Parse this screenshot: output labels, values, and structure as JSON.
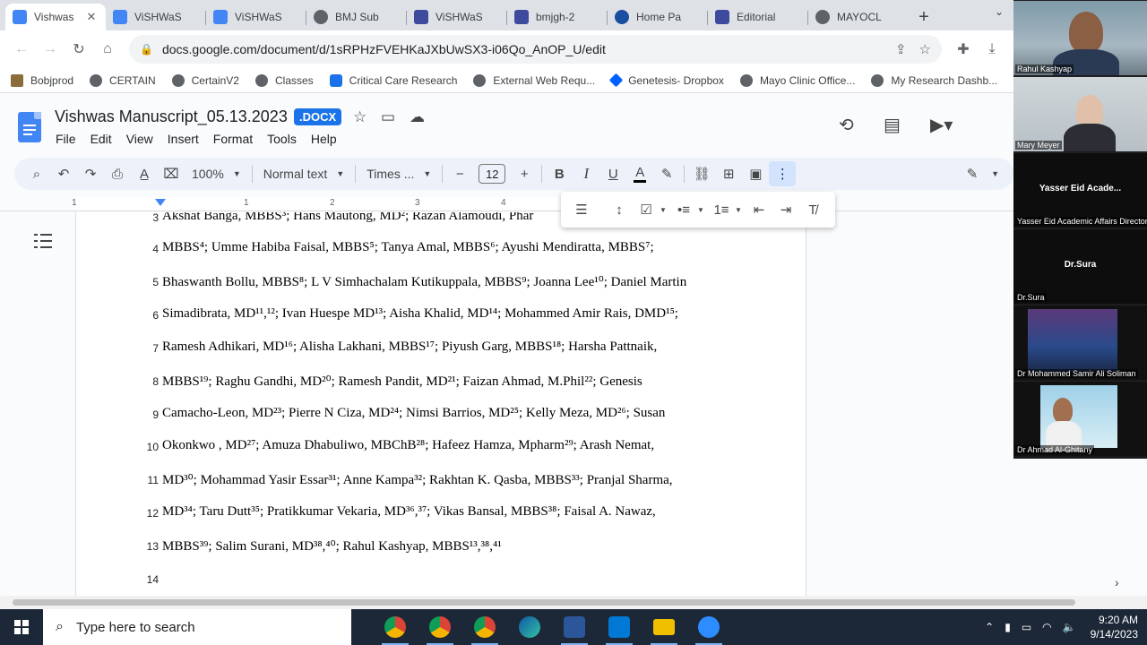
{
  "tabs": [
    {
      "title": "Vishwas",
      "favicon": "docs",
      "active": true
    },
    {
      "title": "ViSHWaS",
      "favicon": "docs"
    },
    {
      "title": "ViSHWaS",
      "favicon": "docs"
    },
    {
      "title": "BMJ Sub",
      "favicon": "globe"
    },
    {
      "title": "ViSHWaS",
      "favicon": "d-logo"
    },
    {
      "title": "bmjgh-2",
      "favicon": "d-logo"
    },
    {
      "title": "Home Pa",
      "favicon": "home"
    },
    {
      "title": "Editorial",
      "favicon": "d-logo"
    },
    {
      "title": "MAYOCL",
      "favicon": "globe"
    }
  ],
  "address": {
    "url": "docs.google.com/document/d/1sRPHzFVEHKaJXbUwSX3-i06Qo_AnOP_U/edit"
  },
  "bookmarks": [
    "Bobjprod",
    "CERTAIN",
    "CertainV2",
    "Classes",
    "Critical Care Research",
    "External Web Requ...",
    "Genetesis- Dropbox",
    "Mayo Clinic Office...",
    "My Research Dashb..."
  ],
  "doc": {
    "title": "Vishwas Manuscript_05.13.2023",
    "badge": ".DOCX",
    "menu": [
      "File",
      "Edit",
      "View",
      "Insert",
      "Format",
      "Tools",
      "Help"
    ]
  },
  "toolbar": {
    "zoom": "100%",
    "style": "Normal text",
    "font": "Times ...",
    "font_size": "12"
  },
  "ruler": [
    "1",
    "1",
    "2",
    "3",
    "4"
  ],
  "lines": [
    {
      "n": "3",
      "text": "Akshat Banga, MBBS³; Hans Mautong, MD²; Razan Alamoudi, Phar"
    },
    {
      "n": "4",
      "text": "MBBS⁴; Umme Habiba Faisal, MBBS⁵; Tanya Amal, MBBS⁶; Ayushi Mendiratta, MBBS⁷;"
    },
    {
      "n": "5",
      "text": "Bhaswanth Bollu, MBBS⁸; L V Simhachalam Kutikuppala, MBBS⁹; Joanna Lee¹⁰; Daniel Martin"
    },
    {
      "n": "6",
      "text": "Simadibrata, MD¹¹,¹²; Ivan Huespe MD¹³; Aisha Khalid, MD¹⁴; Mohammed Amir Rais, DMD¹⁵;"
    },
    {
      "n": "7",
      "text": "Ramesh Adhikari, MD¹⁶; Alisha Lakhani, MBBS¹⁷; Piyush Garg, MBBS¹⁸; Harsha Pattnaik,"
    },
    {
      "n": "8",
      "text": "MBBS¹⁹; Raghu Gandhi, MD²⁰; Ramesh Pandit, MD²¹; Faizan Ahmad, M.Phil²²; Genesis"
    },
    {
      "n": "9",
      "text": "Camacho-Leon, MD²³; Pierre N Ciza, MD²⁴; Nimsi Barrios, MD²⁵; Kelly Meza, MD²⁶; Susan"
    },
    {
      "n": "10",
      "text": "Okonkwo , MD²⁷; Amuza Dhabuliwo, MBChB²⁸; Hafeez Hamza, Mpharm²⁹; Arash Nemat,"
    },
    {
      "n": "11",
      "text": "MD³⁰; Mohammad Yasir Essar³¹; Anne Kampa³²; Rakhtan K. Qasba, MBBS³³; Pranjal Sharma,"
    },
    {
      "n": "12",
      "text": "MD³⁴; Taru Dutt³⁵; Pratikkumar Vekaria, MD³⁶,³⁷; Vikas Bansal, MBBS³⁸; Faisal A. Nawaz,"
    },
    {
      "n": "13",
      "text": "MBBS³⁹; Salim Surani, MD³⁸,⁴⁰; Rahul Kashyap, MBBS¹³,³⁸,⁴¹"
    },
    {
      "n": "14",
      "text": ""
    }
  ],
  "zoom": {
    "participants": [
      {
        "name": "Rahul Kashyap",
        "video": true
      },
      {
        "name": "Mary Meyer",
        "video": true
      },
      {
        "name": "Yasser Eid Academic Affairs Director",
        "label": "Yasser Eid Acade...",
        "video": false
      },
      {
        "name": "Dr.Sura",
        "label": "Dr.Sura",
        "video": false
      },
      {
        "name": "Dr Mohammed Samir Ali Soliman",
        "video": true
      },
      {
        "name": "Dr Ahmad Al-Ghitany",
        "video": true
      }
    ]
  },
  "taskbar": {
    "search_placeholder": "Type here to search",
    "time": "9:20 AM",
    "date": "9/14/2023"
  },
  "colors": {
    "docs_blue": "#4285f4",
    "toolbar_bg": "#edf2fa",
    "taskbar_bg": "#1c2838"
  }
}
